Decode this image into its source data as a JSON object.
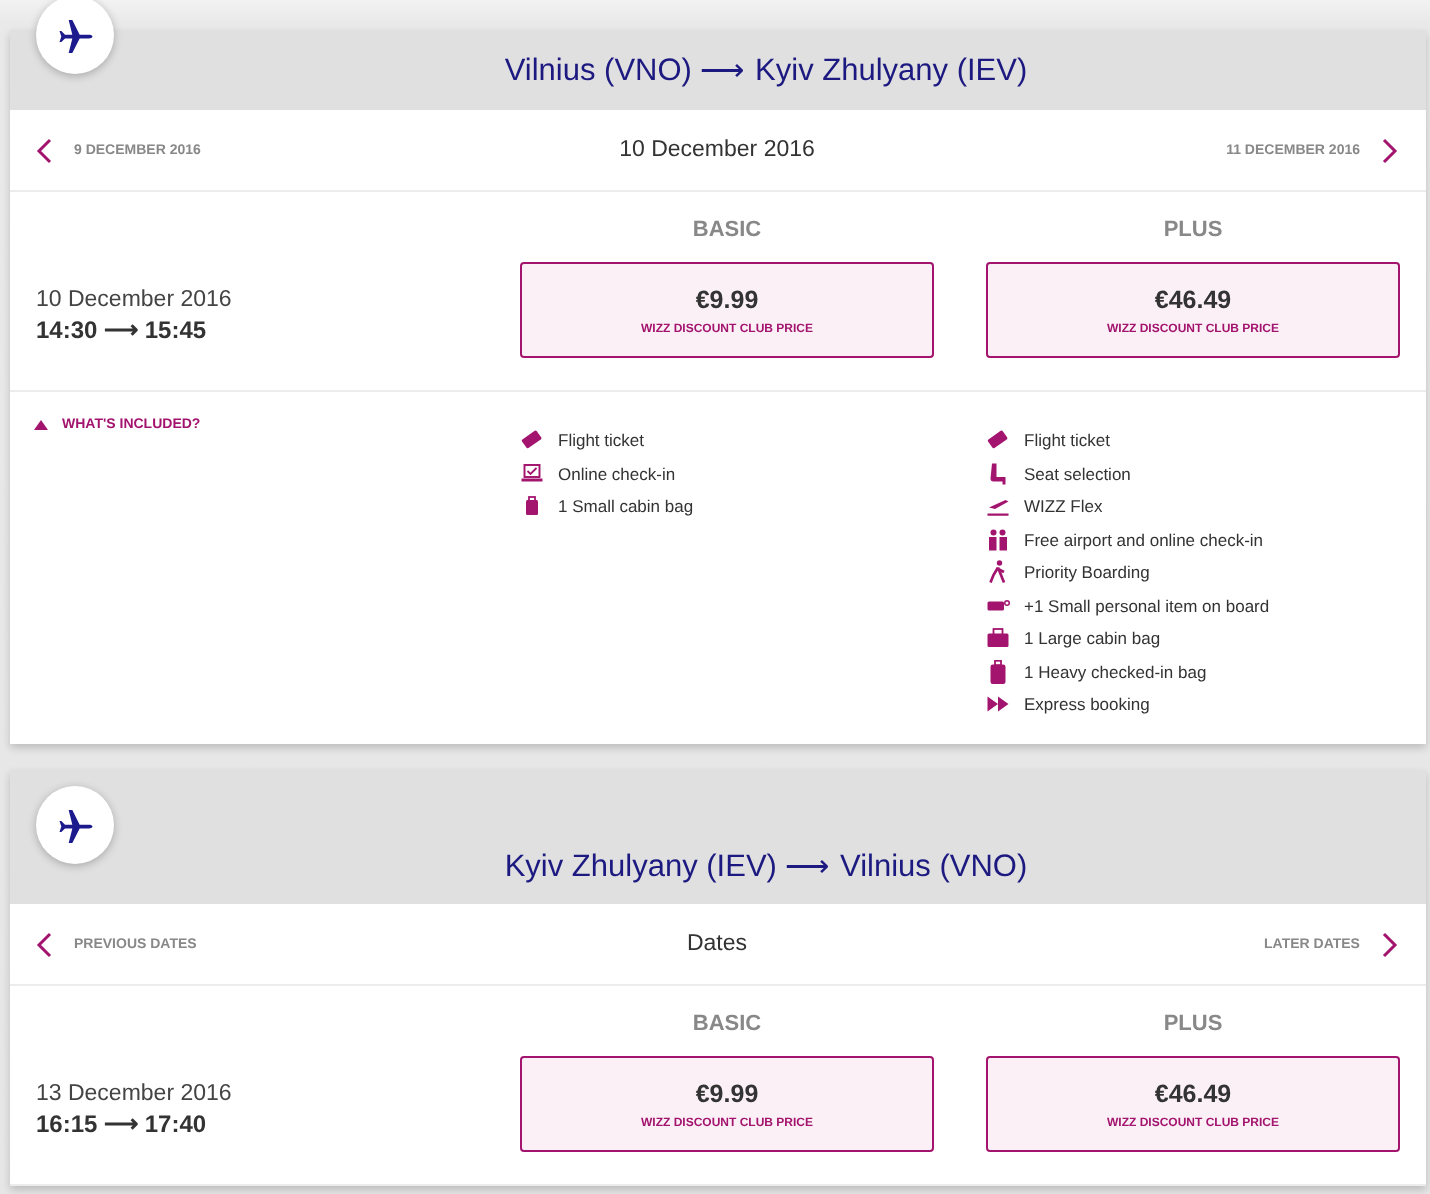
{
  "flights": [
    {
      "route": "Vilnius (VNO) ⟶ Kyiv Zhulyany (IEV)",
      "prev_label": "9 DECEMBER 2016",
      "current_label": "10 December 2016",
      "next_label": "11 DECEMBER 2016",
      "date": "10 December 2016",
      "times": "14:30 ⟶ 15:45",
      "fares": [
        {
          "name": "BASIC",
          "price": "€9.99",
          "note": "WIZZ DISCOUNT CLUB PRICE"
        },
        {
          "name": "PLUS",
          "price": "€46.49",
          "note": "WIZZ DISCOUNT CLUB PRICE"
        }
      ],
      "included": {
        "label": "WHAT'S INCLUDED?",
        "expanded": true,
        "lists": [
          [
            {
              "kind": "ticket",
              "text": "Flight ticket"
            },
            {
              "kind": "checkin",
              "text": "Online check-in"
            },
            {
              "kind": "smallbag",
              "text": "1 Small cabin bag"
            }
          ],
          [
            {
              "kind": "ticket",
              "text": "Flight ticket"
            },
            {
              "kind": "seat",
              "text": "Seat selection"
            },
            {
              "kind": "flex",
              "text": "WIZZ Flex"
            },
            {
              "kind": "people",
              "text": "Free airport and online check-in"
            },
            {
              "kind": "boarding",
              "text": "Priority Boarding"
            },
            {
              "kind": "personal",
              "text": "+1 Small personal item on board"
            },
            {
              "kind": "largebag",
              "text": "1 Large cabin bag"
            },
            {
              "kind": "heavybag",
              "text": "1 Heavy checked-in bag"
            },
            {
              "kind": "express",
              "text": "Express booking"
            }
          ]
        ]
      }
    },
    {
      "route": "Kyiv Zhulyany (IEV) ⟶ Vilnius (VNO)",
      "prev_label": "PREVIOUS DATES",
      "current_label": "Dates",
      "next_label": "LATER DATES",
      "date": "13 December 2016",
      "times": "16:15 ⟶ 17:40",
      "fares": [
        {
          "name": "BASIC",
          "price": "€9.99",
          "note": "WIZZ DISCOUNT CLUB PRICE"
        },
        {
          "name": "PLUS",
          "price": "€46.49",
          "note": "WIZZ DISCOUNT CLUB PRICE"
        }
      ]
    }
  ]
}
